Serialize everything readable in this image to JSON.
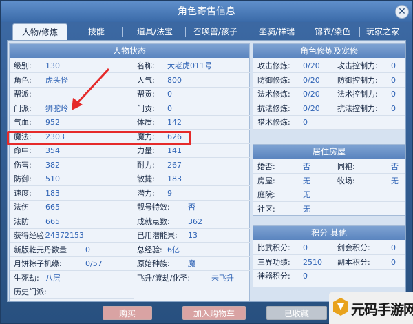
{
  "window": {
    "title": "角色寄售信息",
    "close_symbol": "✕"
  },
  "tabs": [
    {
      "label": "人物/修炼",
      "active": true
    },
    {
      "label": "技能"
    },
    {
      "label": "道具/法宝"
    },
    {
      "label": "召唤兽/孩子"
    },
    {
      "label": "坐骑/祥瑞"
    },
    {
      "label": "锦衣/染色"
    },
    {
      "label": "玩家之家"
    }
  ],
  "status": {
    "title": "人物状态",
    "left": [
      {
        "label": "级别:",
        "value": "130"
      },
      {
        "label": "角色:",
        "value": "虎头怪"
      },
      {
        "label": "帮派:",
        "value": ""
      },
      {
        "label": "门派:",
        "value": "狮驼岭"
      },
      {
        "label": "气血:",
        "value": "952"
      },
      {
        "label": "魔法:",
        "value": "2303"
      },
      {
        "label": "命中:",
        "value": "354"
      },
      {
        "label": "伤害:",
        "value": "382"
      },
      {
        "label": "防御:",
        "value": "510"
      },
      {
        "label": "速度:",
        "value": "183"
      },
      {
        "label": "法伤",
        "value": "665"
      },
      {
        "label": "法防",
        "value": "665"
      },
      {
        "label": "获得经验:",
        "value": "24372153"
      },
      {
        "label": "新版乾元丹数量",
        "value": "0"
      },
      {
        "label": "月饼粽子机缘:",
        "value": "0/57"
      },
      {
        "label": "生死劫:",
        "value": "八层"
      },
      {
        "label": "历史门派:",
        "value": ""
      }
    ],
    "right": [
      {
        "label": "名称:",
        "value": "大老虎011号"
      },
      {
        "label": "人气:",
        "value": "800"
      },
      {
        "label": "帮贡:",
        "value": "0"
      },
      {
        "label": "门贡:",
        "value": "0"
      },
      {
        "label": "体质:",
        "value": "142"
      },
      {
        "label": "魔力:",
        "value": "626"
      },
      {
        "label": "力量:",
        "value": "141"
      },
      {
        "label": "耐力:",
        "value": "267"
      },
      {
        "label": "敏捷:",
        "value": "183"
      },
      {
        "label": "潜力:",
        "value": "9"
      },
      {
        "label": "靓号特效:",
        "value": "否"
      },
      {
        "label": "成就点数:",
        "value": "362"
      },
      {
        "label": "已用潜能果:",
        "value": "13"
      },
      {
        "label": "总经验:",
        "value": "6亿"
      },
      {
        "label": "原始种族:",
        "value": "魔"
      },
      {
        "label": "飞升/渡劫/化圣:",
        "value": "未飞升"
      }
    ]
  },
  "cultivation": {
    "title": "角色修炼及宠修",
    "rows": [
      {
        "l_label": "攻击修炼:",
        "l_value": "0/20",
        "r_label": "攻击控制力:",
        "r_value": "0"
      },
      {
        "l_label": "防御修炼:",
        "l_value": "0/20",
        "r_label": "防御控制力:",
        "r_value": "0"
      },
      {
        "l_label": "法术修炼:",
        "l_value": "0/20",
        "r_label": "法术控制力:",
        "r_value": "0"
      },
      {
        "l_label": "抗法修炼:",
        "l_value": "0/20",
        "r_label": "抗法控制力:",
        "r_value": "0"
      },
      {
        "l_label": "猎术修炼:",
        "l_value": "0",
        "r_label": "",
        "r_value": ""
      }
    ]
  },
  "housing": {
    "title": "居住房屋",
    "rows": [
      {
        "l_label": "婚否:",
        "l_value": "否",
        "r_label": "同袍:",
        "r_value": "否"
      },
      {
        "l_label": "房屋:",
        "l_value": "无",
        "r_label": "牧场:",
        "r_value": "无"
      },
      {
        "l_label": "庭院:",
        "l_value": "无",
        "r_label": "",
        "r_value": ""
      },
      {
        "l_label": "社区:",
        "l_value": "无",
        "r_label": "",
        "r_value": ""
      }
    ]
  },
  "points": {
    "title": "积分 其他",
    "rows": [
      {
        "l_label": "比武积分:",
        "l_value": "0",
        "r_label": "剑会积分:",
        "r_value": "0"
      },
      {
        "l_label": "三界功绩:",
        "l_value": "2510",
        "r_label": "副本积分:",
        "r_value": "0"
      },
      {
        "l_label": "神器积分:",
        "l_value": "0",
        "r_label": "",
        "r_value": ""
      }
    ]
  },
  "actions": {
    "buy": "购买",
    "add_cart": "加入购物车",
    "favorited": "已收藏"
  },
  "watermark": {
    "text": "元码手游网"
  },
  "colors": {
    "highlight": "#e52a2a",
    "value_text": "#2f63b5",
    "header_bg": "#5a84bf"
  }
}
